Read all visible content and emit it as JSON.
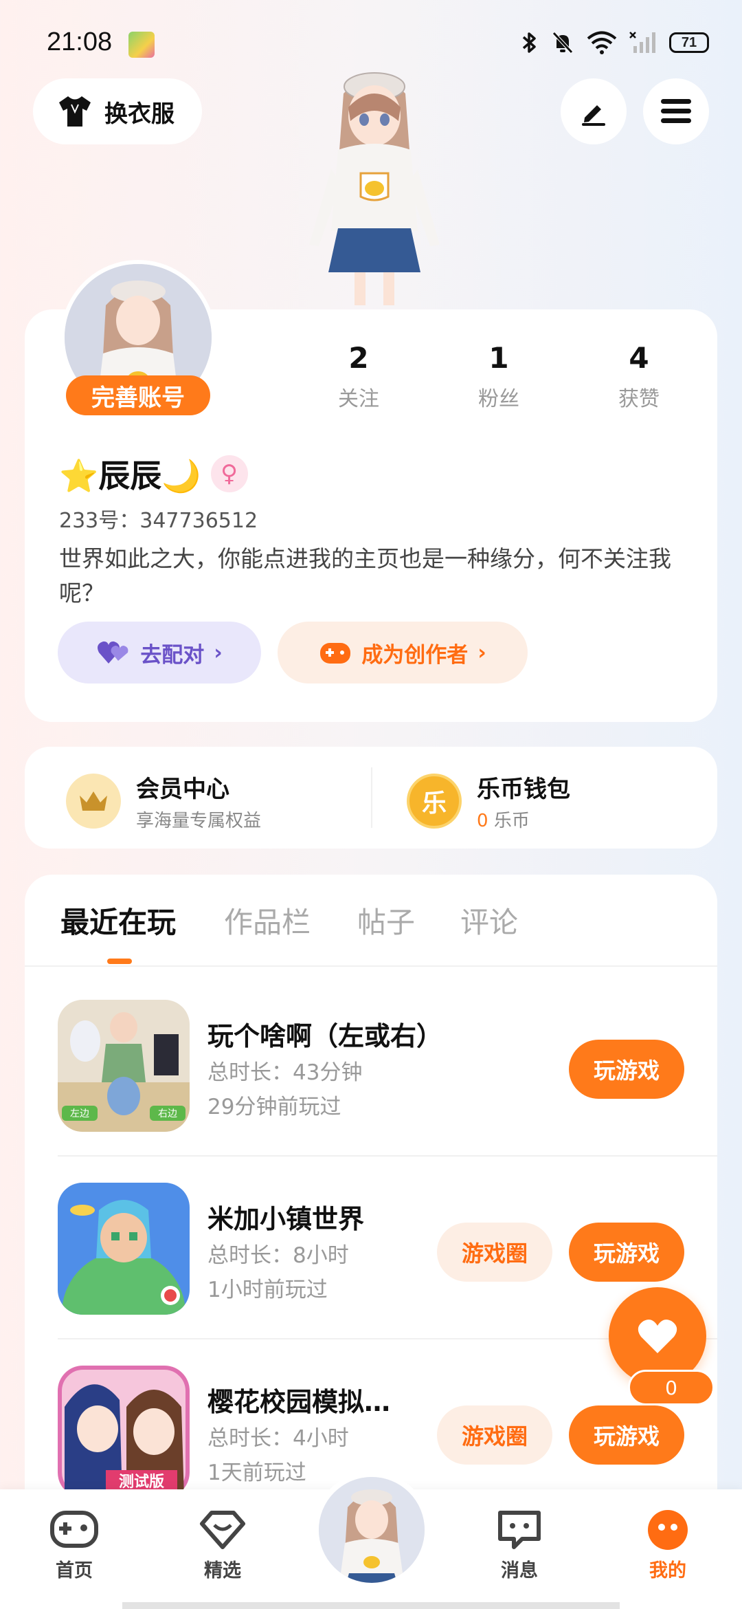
{
  "status_bar": {
    "time": "21:08",
    "battery": "71"
  },
  "header": {
    "outfit_label": "换衣服"
  },
  "profile": {
    "complete_account": "完善账号",
    "stats": [
      {
        "value": "2",
        "label": "关注"
      },
      {
        "value": "1",
        "label": "粉丝"
      },
      {
        "value": "4",
        "label": "获赞"
      }
    ],
    "nickname": "⭐辰辰🌙",
    "gender_icon": "♀",
    "user_id": "233号：347736512",
    "bio": "世界如此之大，你能点进我的主页也是一种缘分，何不关注我呢？",
    "pair_label": "去配对",
    "creator_label": "成为创作者"
  },
  "membership": {
    "vip_title": "会员中心",
    "vip_sub": "享海量专属权益",
    "wallet_title": "乐币钱包",
    "wallet_amount": "0",
    "wallet_unit": "乐币",
    "wallet_icon_char": "乐"
  },
  "tabs": [
    {
      "label": "最近在玩",
      "active": true
    },
    {
      "label": "作品栏",
      "active": false
    },
    {
      "label": "帖子",
      "active": false
    },
    {
      "label": "评论",
      "active": false
    }
  ],
  "games": [
    {
      "name": "玩个啥啊（左或右）",
      "duration": "总时长：43分钟",
      "last_played": "29分钟前玩过",
      "play_label": "玩游戏",
      "circle_label": "",
      "icon_left": "左边",
      "icon_right": "右边"
    },
    {
      "name": "米加小镇世界",
      "duration": "总时长：8小时",
      "last_played": "1小时前玩过",
      "play_label": "玩游戏",
      "circle_label": "游戏圈"
    },
    {
      "name": "樱花校园模拟…",
      "duration": "总时长：4小时",
      "last_played": "1天前玩过",
      "play_label": "玩游戏",
      "circle_label": "游戏圈",
      "icon_badge": "测试版"
    }
  ],
  "float_like": {
    "count": "0"
  },
  "bottom_nav": [
    {
      "label": "首页",
      "icon": "gamepad-icon"
    },
    {
      "label": "精选",
      "icon": "heart-diamond-icon"
    },
    {
      "label": "",
      "icon": "avatar"
    },
    {
      "label": "消息",
      "icon": "chat-icon"
    },
    {
      "label": "我的",
      "icon": "profile-icon",
      "active": true
    }
  ],
  "colors": {
    "accent": "#ff7a1a",
    "pair": "#6a52c8",
    "vip_gold": "#f4c24d"
  }
}
